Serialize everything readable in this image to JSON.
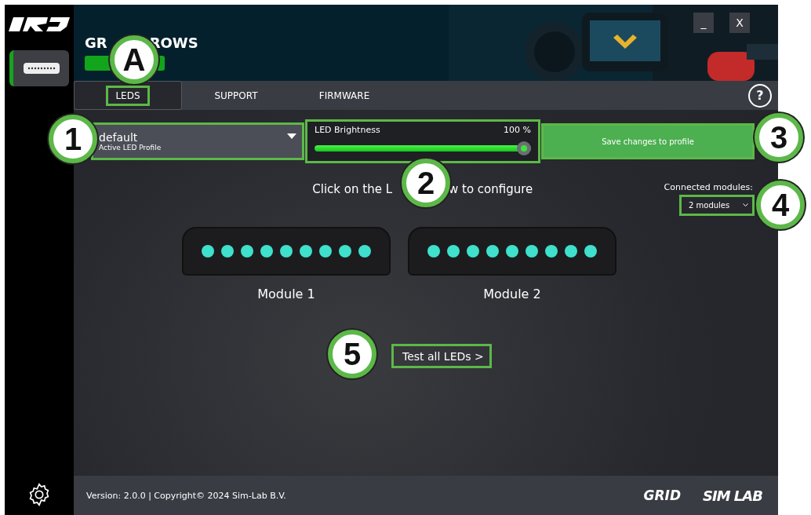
{
  "sidebar": {
    "device_selected": true
  },
  "header": {
    "title_parts": [
      "GR",
      "ROWS"
    ],
    "window_buttons": [
      "_",
      "X"
    ]
  },
  "tabs": [
    {
      "label": "LEDS",
      "selected": true,
      "highlighted": true
    },
    {
      "label": "SUPPORT",
      "selected": false,
      "highlighted": false
    },
    {
      "label": "FIRMWARE",
      "selected": false,
      "highlighted": false
    }
  ],
  "help": "?",
  "profile": {
    "value": "default",
    "caption": "Active LED Profile",
    "highlighted": true
  },
  "brightness": {
    "label": "LED Brightness",
    "reading": "100 %",
    "level": 1,
    "highlighted": true
  },
  "save_button": {
    "label": "Save changes to profile",
    "highlighted": true
  },
  "instruction_parts": [
    "Click on the L",
    "w to configure"
  ],
  "connected": {
    "label": "Connected modules:",
    "value": "2 modules",
    "highlighted": true
  },
  "modules": [
    {
      "name": "Module 1",
      "leds": [
        {
          "lit": true
        },
        {
          "lit": true
        },
        {
          "lit": true
        },
        {
          "lit": true
        },
        {
          "lit": true
        },
        {
          "lit": true
        },
        {
          "lit": true
        },
        {
          "lit": true
        },
        {
          "lit": true
        }
      ]
    },
    {
      "name": "Module 2",
      "leds": [
        {
          "lit": true
        },
        {
          "lit": true
        },
        {
          "lit": true
        },
        {
          "lit": true
        },
        {
          "lit": true
        },
        {
          "lit": true
        },
        {
          "lit": true
        },
        {
          "lit": true
        },
        {
          "lit": true
        }
      ]
    }
  ],
  "test_button": {
    "label": "Test all LEDs >",
    "highlighted": true
  },
  "footer": {
    "text": "Version: 2.0.0 | Copyright© 2024 Sim-Lab B.V.",
    "logos": [
      "GRID",
      "SIM LAB"
    ]
  },
  "callouts": [
    {
      "label": "A"
    },
    {
      "label": "1"
    },
    {
      "label": "2"
    },
    {
      "label": "3"
    },
    {
      "label": "4"
    },
    {
      "label": "5"
    }
  ]
}
